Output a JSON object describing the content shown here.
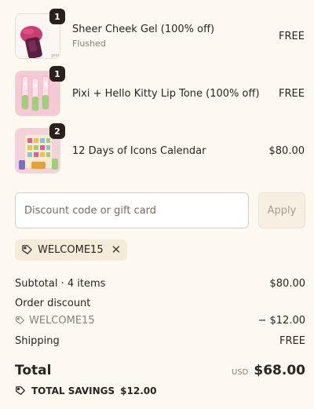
{
  "line_items": [
    {
      "name": "Sheer Cheek Gel (100% off)",
      "variant": "Flushed",
      "price": "FREE",
      "quantity": "1",
      "thumb_icon": "cheek-gel-product-image"
    },
    {
      "name": "Pixi + Hello Kitty Lip Tone (100% off)",
      "variant": "",
      "price": "FREE",
      "quantity": "1",
      "thumb_icon": "lip-tone-product-image"
    },
    {
      "name": "12 Days of Icons Calendar",
      "variant": "",
      "price": "$80.00",
      "quantity": "2",
      "thumb_icon": "advent-calendar-product-image"
    }
  ],
  "discount": {
    "placeholder": "Discount code or gift card",
    "apply_label": "Apply",
    "applied_code": "WELCOME15"
  },
  "totals": {
    "subtotal_label": "Subtotal · 4 items",
    "subtotal_value": "$80.00",
    "order_discount_label": "Order discount",
    "discount_code": "WELCOME15",
    "discount_value": "− $12.00",
    "shipping_label": "Shipping",
    "shipping_value": "FREE",
    "total_label": "Total",
    "currency": "USD",
    "total_value": "$68.00",
    "savings_label": "TOTAL SAVINGS",
    "savings_value": "$12.00"
  },
  "colors": {
    "background": "#fdf8f0",
    "text": "#2b2420",
    "muted": "#8a8178",
    "badge": "#2a211d",
    "chip": "#f4ebd8"
  }
}
